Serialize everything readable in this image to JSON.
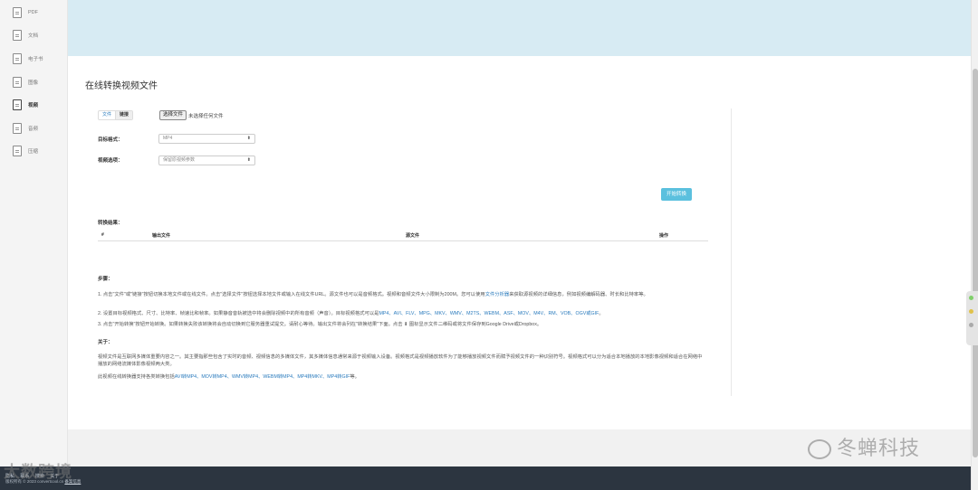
{
  "sidebar": {
    "items": [
      {
        "label": "PDF"
      },
      {
        "label": "文档"
      },
      {
        "label": "电子书"
      },
      {
        "label": "图像"
      },
      {
        "label": "视频"
      },
      {
        "label": "音频"
      },
      {
        "label": "压缩"
      }
    ]
  },
  "main": {
    "title": "在线转换视频文件",
    "tabs": [
      "文件",
      "链接"
    ],
    "file_button": "选择文件",
    "file_none": "未选择任何文件",
    "target_format_label": "目标格式：",
    "target_format_value": "MP4",
    "video_options_label": "视频选项：",
    "video_options_value": "保留原视频参数",
    "start_button": "开始转换",
    "result_label": "转换结果：",
    "table_headers": [
      "#",
      "输出文件",
      "源文件",
      "操作"
    ]
  },
  "steps": {
    "title": "步骤：",
    "line1_a": "1. 点击\"文件\"或\"链接\"按钮切换本地文件或在线文件。点击\"选择文件\"按钮选择本地文件或输入在线文件URL。源文件也可以是音频格式。视频和音频文件大小限制为200M。您可以使用",
    "line1_link": "文件分析器",
    "line1_b": "来获取源视频的详细信息，例如视频编解码器、时长和比特率等。",
    "line2_a": "2. 设置目标视频格式、尺寸、比特率、帧速比和帧率。如果静音音轨被选中将会删除视频中的所有音频（声音）。目标视频格式可以是",
    "line2_links": "MP4、AVI、FLV、MPG、MKV、WMV、M2TS、WEBM、ASF、MOV、M4V、RM、VOB、OGV或GIF",
    "line2_b": "。",
    "line3": "3. 点击\"开始转换\"按钮开始转换。如果转换失败该转换将会自动切换到它服务器重试提交。请耐心等待。输出文件将会列在\"转换结果\"下面。点击 ⬇ 图标显示文件二维码或将文件保存到Google Drive或Dropbox。"
  },
  "about": {
    "title": "关于：",
    "para": "视频文件是互联网多媒体重要内容之一。其主要指那些包含了实时的音频、视频信息的多媒体文件，其多媒体信息通常来源于视频输入设备。视频格式是视频播放软件为了能够播放视频文件而赋予视频文件的一种识别符号。视频格式可以分为适合本地播放的本地影像视频和适合在网络中播放的网络流媒体影像视频两大类。",
    "line_a": "此视频在线转换器支持各类转换包括",
    "line_links": "AVI转MP4、MOV转MP4、WMV转MP4、WEBM转MP4、MP4转MKV、MP4转GIF",
    "line_b": "等。"
  },
  "footer": {
    "links": [
      "隐私",
      "联系",
      "搜索",
      "关于"
    ],
    "copyright": "版权所有 © 2023 convertcool.cn",
    "icp": "备案信息"
  },
  "watermarks": {
    "left": "大数跨境",
    "right": "冬蝉科技"
  },
  "colors": {
    "banner": "#d7ebf3",
    "accent": "#5bc0de",
    "link": "#2a7bbd",
    "footer": "#2c3540"
  }
}
